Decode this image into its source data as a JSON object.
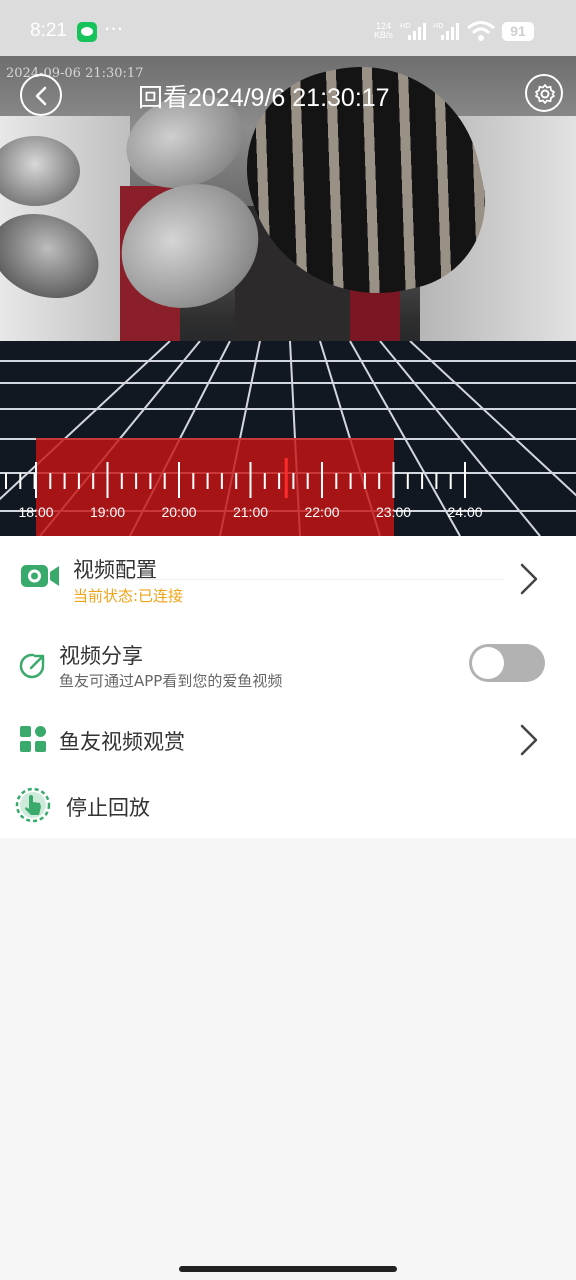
{
  "status_bar": {
    "time": "8:21",
    "more": "···",
    "net_speed_value": "124",
    "net_speed_unit": "KB/s",
    "hd1": "HD",
    "hd2": "HD",
    "battery": "91"
  },
  "video": {
    "camera_timestamp": "2024-09-06 21:30:17",
    "title": "回看2024/9/6 21:30:17",
    "timeline_labels": [
      "18:00",
      "19:00",
      "20:00",
      "21:00",
      "22:00",
      "23:00",
      "24:00"
    ]
  },
  "menu": {
    "video_config": {
      "label": "视频配置",
      "status": "当前状态:已连接"
    },
    "video_share": {
      "label": "视频分享",
      "description": "鱼友可通过APP看到您的爱鱼视频",
      "enabled": false
    },
    "fish_videos": {
      "label": "鱼友视频观赏"
    },
    "stop_playback": {
      "label": "停止回放"
    }
  },
  "colors": {
    "accent_green": "#3aaa6c",
    "status_orange": "#f0a318",
    "recorded_red": "#c81414"
  }
}
